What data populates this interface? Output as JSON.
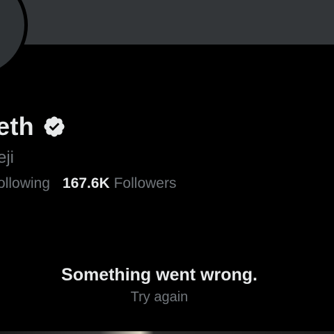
{
  "profile": {
    "display_name": "eth",
    "handle_fragment": "eji",
    "verified_icon": "verified-badge-icon",
    "stats": {
      "following_label": "ollowing",
      "followers_value": "167.6K",
      "followers_label": "Followers"
    }
  },
  "error": {
    "message": "Something went wrong.",
    "retry_label": "Try again"
  },
  "colors": {
    "background": "#000000",
    "banner": "#333639",
    "primary_text": "#e7e9ea",
    "secondary_text": "#71767b"
  }
}
